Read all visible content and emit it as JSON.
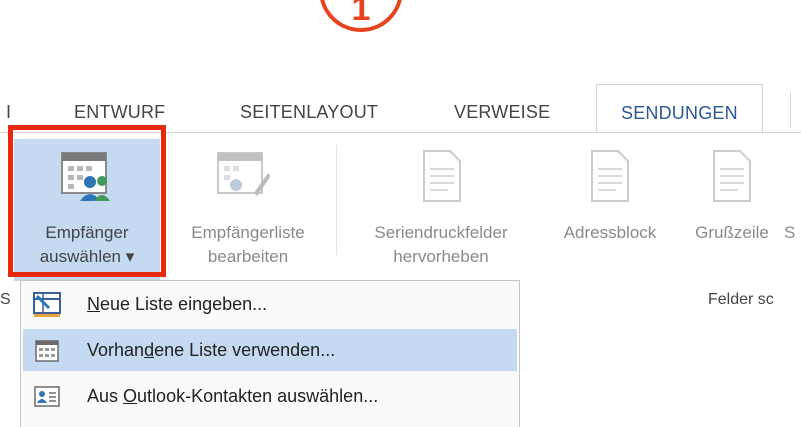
{
  "step": {
    "number": "1"
  },
  "tabs": {
    "cut_left": "I",
    "items": [
      "ENTWURF",
      "SEITENLAYOUT",
      "VERWEISE"
    ],
    "active": "SENDUNGEN"
  },
  "ribbon": {
    "buttons": [
      {
        "line1": "Empfänger",
        "line2": "auswählen ▾",
        "selected": true,
        "icon": "calendar-contacts-icon"
      },
      {
        "line1": "Empfängerliste",
        "line2": "bearbeiten",
        "disabled": true,
        "icon": "calendar-edit-icon"
      },
      {
        "line1": "Seriendruckfelder",
        "line2": "hervorheben",
        "disabled": true,
        "icon": "document-icon"
      },
      {
        "line1": "Adressblock",
        "line2": "",
        "disabled": true,
        "icon": "document-icon"
      },
      {
        "line1": "Grußzeile",
        "line2": "",
        "disabled": true,
        "icon": "document-icon"
      },
      {
        "line1": "S",
        "line2": "",
        "disabled": true,
        "icon": ""
      }
    ],
    "group_labels": {
      "left_cut": "S",
      "right": "Felder sc"
    }
  },
  "menu": {
    "items": [
      {
        "pre": "",
        "accel": "N",
        "post": "eue Liste eingeben...",
        "icon": "new-list-icon",
        "hover": false
      },
      {
        "pre": "Vorhan",
        "accel": "d",
        "post": "ene Liste verwenden...",
        "icon": "table-icon",
        "hover": true
      },
      {
        "pre": "Aus ",
        "accel": "O",
        "post": "utlook-Kontakten auswählen...",
        "icon": "contact-card-icon",
        "hover": false
      }
    ]
  },
  "colors": {
    "accent": "#2b579a",
    "highlight": "#e8290c",
    "selected_bg": "#c5d9f1"
  }
}
